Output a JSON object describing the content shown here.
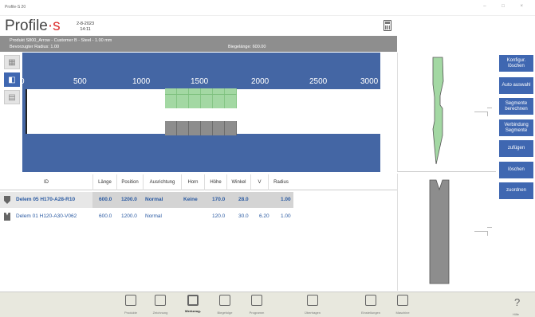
{
  "window": {
    "title": "Profile-S 20",
    "controls": "– □ ×"
  },
  "header": {
    "logo_text": "Profile",
    "logo_dot": "·s",
    "date": "2-8-2023",
    "time": "14:11"
  },
  "info": {
    "product": "Produkt S800_Arrow - Customer B - Steel - 1.00 mm",
    "radius": "Bevorzugter Radius: 1.00",
    "bend_length": "Biegelänge: 600.00"
  },
  "ruler": {
    "labels": [
      "0",
      "500",
      "1000",
      "1500",
      "2000",
      "2500",
      "3000"
    ]
  },
  "actions": [
    "Konfigur. löschen",
    "Auto auswahl",
    "Segmente berechnen",
    "Verbindung Segmente",
    "zufügen",
    "löschen",
    "zuordnen"
  ],
  "table": {
    "columns": [
      "ID",
      "Länge",
      "Position",
      "Ausrichtung",
      "Horn",
      "Höhe",
      "Winkel",
      "V",
      "Radius"
    ],
    "rows": [
      {
        "id": "Delem 05 H170-A28-R10",
        "laenge": "600.0",
        "position": "1200.0",
        "ausrichtung": "Normal",
        "horn": "Keine",
        "hoehe": "170.0",
        "winkel": "28.0",
        "v": "",
        "radius": "1.00"
      },
      {
        "id": "Delem 01 H120-A30-V062",
        "laenge": "600.0",
        "position": "1200.0",
        "ausrichtung": "Normal",
        "horn": "",
        "hoehe": "120.0",
        "winkel": "30.0",
        "v": "6.20",
        "radius": "1.00"
      }
    ]
  },
  "nav": [
    "Produkte",
    "Zeichnung",
    "Werkzeug-",
    "Biegefolge",
    "Programm",
    "Übertragen",
    "Einstellungen",
    "Maschine"
  ],
  "help": {
    "symbol": "?",
    "label": "Hilfe"
  },
  "colors": {
    "accent": "#3f67b1",
    "drawing_bg": "#4466a4",
    "upper_tool": "#a3d8a3",
    "lower_tool": "#8d8d8d",
    "info_bar": "#8e8e8e"
  }
}
